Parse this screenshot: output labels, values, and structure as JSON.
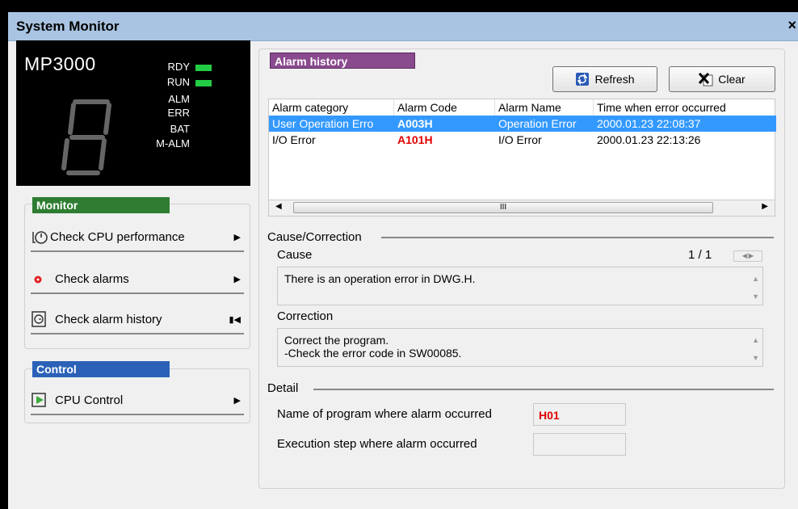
{
  "window": {
    "title": "System Monitor",
    "close_label": "×"
  },
  "status": {
    "model": "MP3000",
    "leds": [
      {
        "label": "RDY",
        "on": true
      },
      {
        "label": "RUN",
        "on": true
      },
      {
        "label": "ALM",
        "on": false
      },
      {
        "label": "ERR",
        "on": false
      },
      {
        "label": "BAT",
        "on": false
      },
      {
        "label": "M-ALM",
        "on": false
      }
    ],
    "led_color": "#22cc44"
  },
  "monitor": {
    "header": "Monitor",
    "header_color": "#2e7d32",
    "items": [
      {
        "label": "Check CPU performance",
        "icon": "stopwatch-icon"
      },
      {
        "label": "Check alarms",
        "icon": "red-dot-icon"
      },
      {
        "label": "Check alarm history",
        "icon": "history-icon"
      }
    ]
  },
  "control": {
    "header": "Control",
    "header_color": "#2b62b8",
    "items": [
      {
        "label": "CPU Control",
        "icon": "cpu-control-icon"
      }
    ]
  },
  "alarm_history": {
    "header": "Alarm history",
    "header_color": "#8a4a8e",
    "refresh_label": "Refresh",
    "clear_label": "Clear",
    "columns": [
      "Alarm category",
      "Alarm Code",
      "Alarm Name",
      "Time when error occurred"
    ],
    "rows": [
      {
        "category": "User Operation Erro",
        "code": "A003H",
        "name": "Operation Error",
        "time": "2000.01.23 22:08:37",
        "selected": true
      },
      {
        "category": "I/O Error",
        "code": "A101H",
        "name": "I/O Error",
        "time": "2000.01.23 22:13:26",
        "selected": false
      }
    ],
    "scroll_thumb_label": "III"
  },
  "cause_correction": {
    "title": "Cause/Correction",
    "cause_label": "Cause",
    "page": "1 / 1",
    "cause_text": "There is an operation error in DWG.H.",
    "correction_label": "Correction",
    "correction_lines": [
      "Correct the program.",
      "-Check the error code in SW00085."
    ]
  },
  "detail": {
    "title": "Detail",
    "program_label": "Name of program where alarm occurred",
    "program_value": "H01",
    "step_label": "Execution step where alarm occurred",
    "step_value": ""
  }
}
